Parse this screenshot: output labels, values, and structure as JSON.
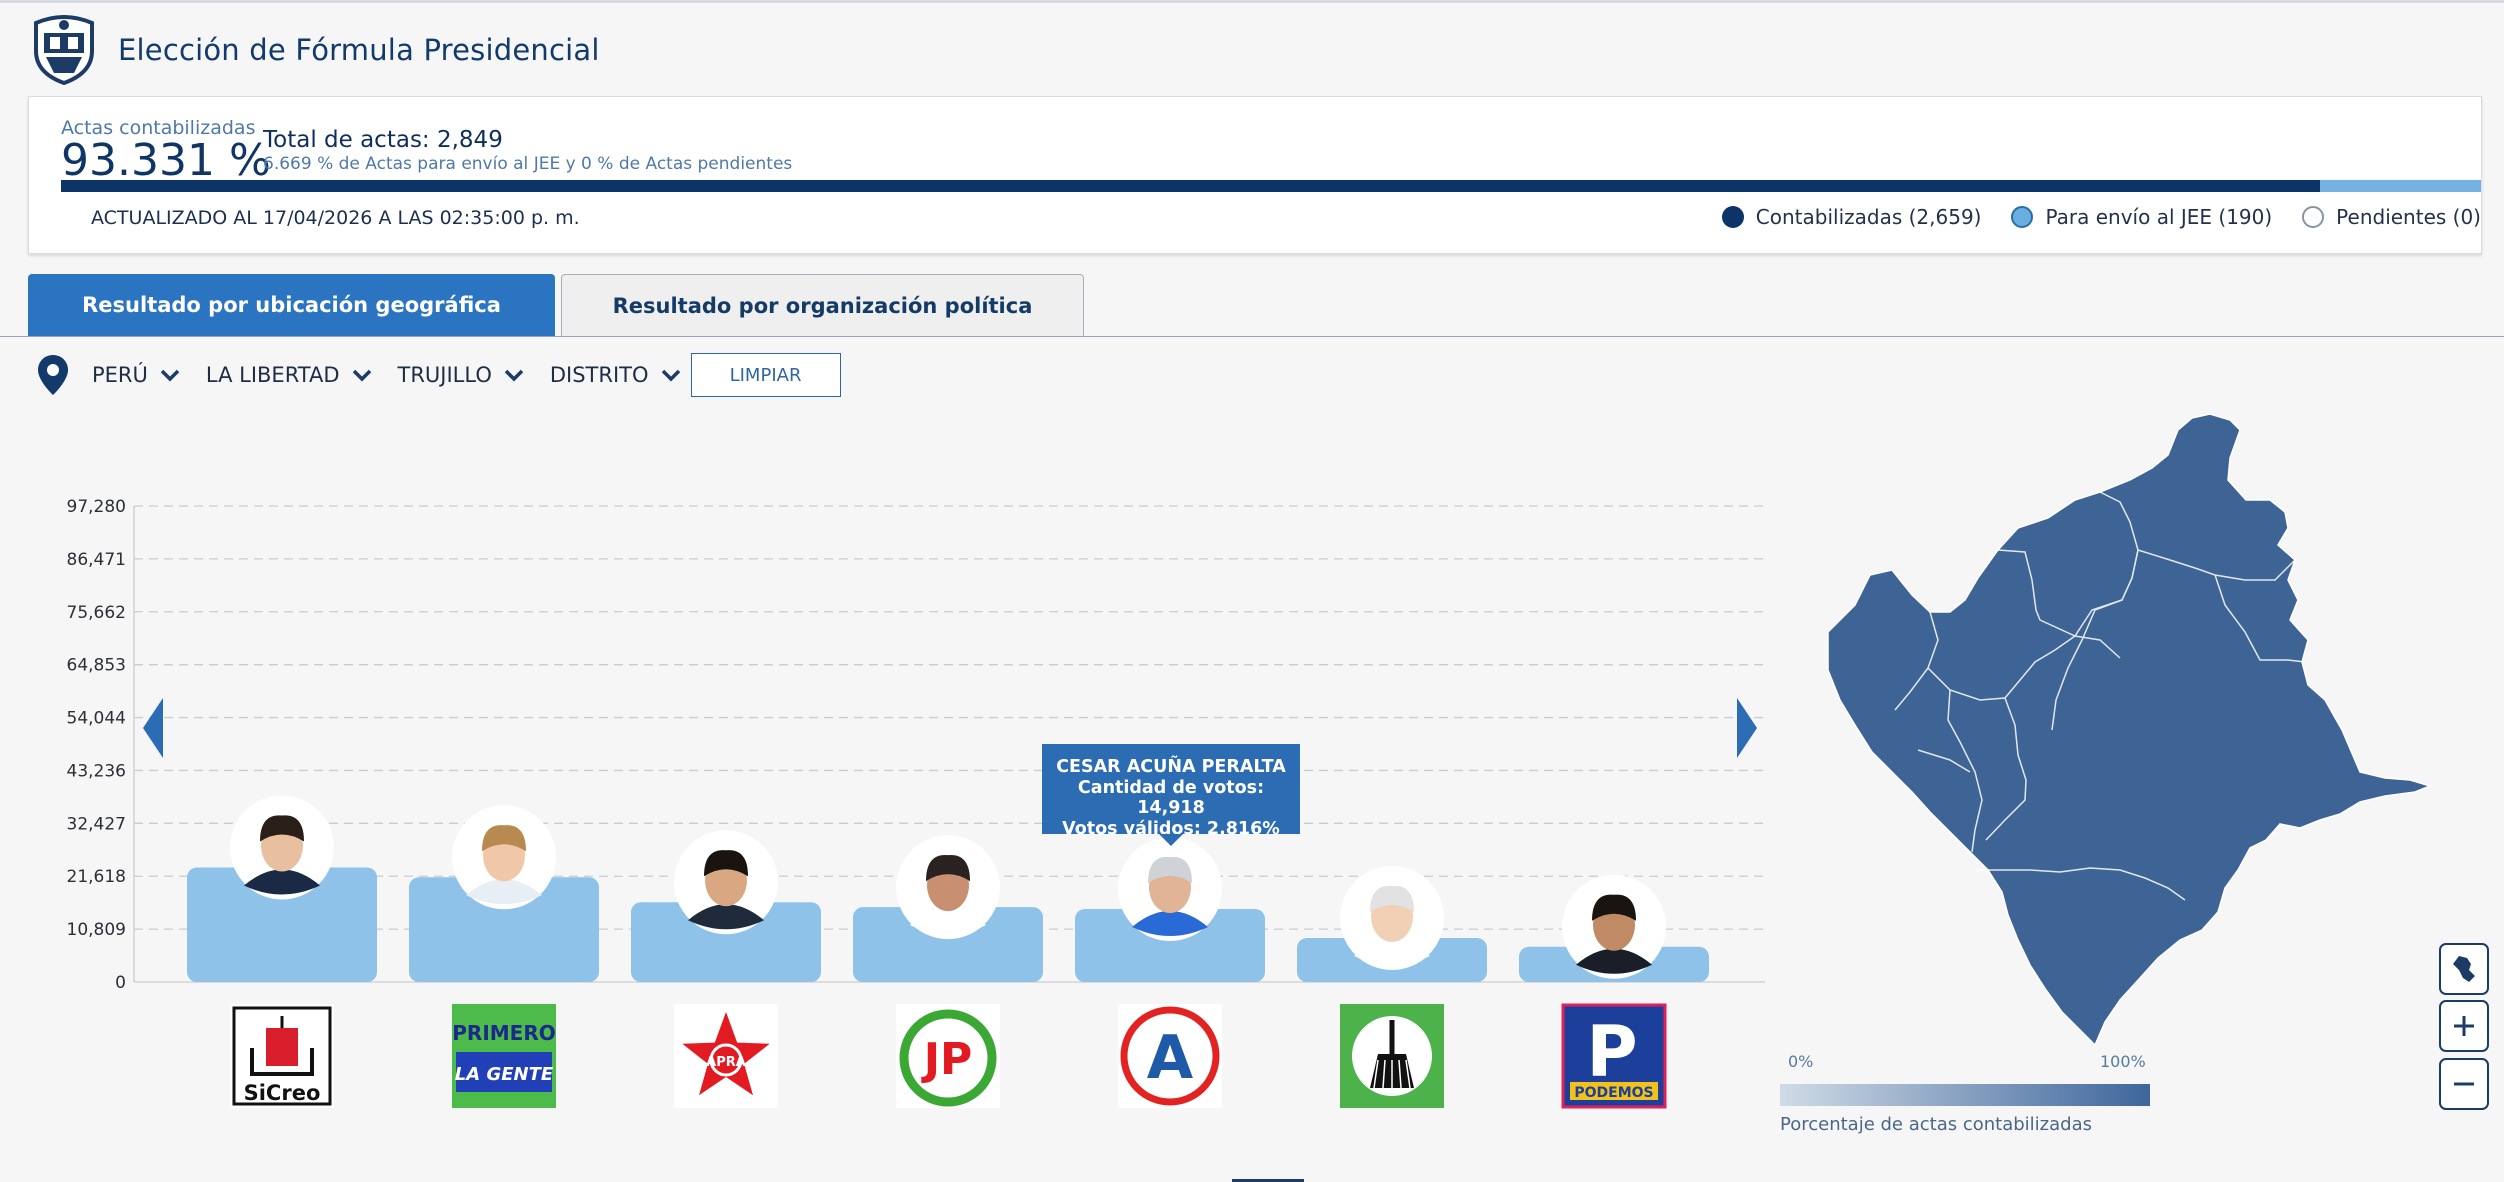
{
  "header": {
    "title": "Elección de Fórmula Presidencial"
  },
  "summary": {
    "actas_label": "Actas contabilizadas",
    "actas_pct": "93.331 %",
    "total_actas": "Total de actas: 2,849",
    "subtext": "6.669 % de Actas para envío al JEE y 0 % de Actas pendientes",
    "progress": {
      "contabilizadas_pct": 93.331,
      "jee_pct": 6.669,
      "pendientes_pct": 0
    },
    "updated": "ACTUALIZADO AL 17/04/2026 A LAS 02:35:00 p. m.",
    "legend": [
      {
        "label": "Contabilizadas (2,659)",
        "color": "#0c3468"
      },
      {
        "label": "Para envío al JEE (190)",
        "color": "#6aaee0"
      },
      {
        "label": "Pendientes (0)",
        "color": "#ffffff"
      }
    ]
  },
  "tabs": [
    {
      "label": "Resultado por ubicación geográfica",
      "active": true
    },
    {
      "label": "Resultado por organización política",
      "active": false
    }
  ],
  "filters": {
    "pais": "PERÚ",
    "region": "LA LIBERTAD",
    "provincia": "TRUJILLO",
    "distrito": "DISTRITO",
    "clear_label": "LIMPIAR"
  },
  "tooltip": {
    "name": "CESAR ACUÑA PERALTA",
    "votes": "Cantidad de votos: 14,918",
    "valid": "Votos válidos: 2.816%"
  },
  "chart_data": {
    "type": "bar",
    "yticks": [
      "97,280",
      "86,471",
      "75,662",
      "64,853",
      "54,044",
      "43,236",
      "32,427",
      "21,618",
      "10,809",
      "0"
    ],
    "ylim": [
      0,
      97280
    ],
    "grid": true,
    "values": [
      23400,
      21400,
      16300,
      15300,
      14918,
      9000,
      7200
    ],
    "parties": [
      {
        "logo": "SiCreo"
      },
      {
        "logo": "PRIMERO LA GENTE"
      },
      {
        "logo": "APRA"
      },
      {
        "logo": "JP"
      },
      {
        "logo": "A"
      },
      {
        "logo": "broom-logo"
      },
      {
        "logo": "PODEMOS"
      }
    ],
    "bar_color": "#8ec2e8"
  },
  "map": {
    "legend_min": "0%",
    "legend_max": "100%",
    "caption": "Porcentaje de actas contabilizadas",
    "fill": "#3d6494"
  }
}
